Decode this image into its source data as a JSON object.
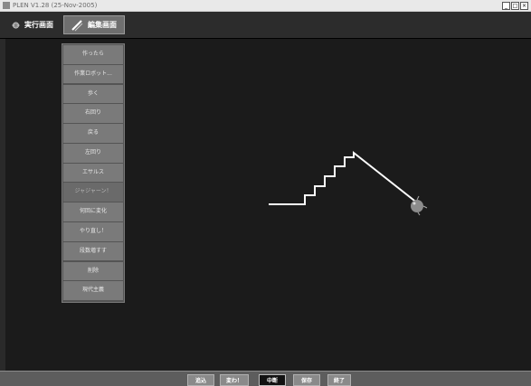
{
  "window": {
    "title": "PLEN V1.28 (25-Nov-2005)",
    "controls": [
      "_",
      "□",
      "×"
    ]
  },
  "toolbar": {
    "run_label": "実行画面",
    "edit_label": "編集画面"
  },
  "command_menu": {
    "items": [
      {
        "label": "作ったら",
        "enabled": true
      },
      {
        "label": "作業ロボット...",
        "enabled": true
      },
      {
        "label": "歩く",
        "enabled": true
      },
      {
        "label": "右回り",
        "enabled": true
      },
      {
        "label": "戻る",
        "enabled": true
      },
      {
        "label": "左回り",
        "enabled": true
      },
      {
        "label": "エサルス",
        "enabled": true
      },
      {
        "label": "ジャジャーン！",
        "enabled": false
      },
      {
        "label": "何回に変化",
        "enabled": true
      },
      {
        "label": "やり直し！",
        "enabled": true
      },
      {
        "label": "段数増すす",
        "enabled": true
      },
      {
        "label": "削除",
        "enabled": true
      },
      {
        "label": "現代主義",
        "enabled": true
      }
    ]
  },
  "canvas": {
    "line_color": "#ffffff",
    "robot_color": "#8c8c8c"
  },
  "bottom_bar": {
    "buttons": [
      {
        "label": "追込",
        "active": false
      },
      {
        "label": "変わ！",
        "active": false
      },
      {
        "label": "中断",
        "active": true
      },
      {
        "label": "保存",
        "active": false
      },
      {
        "label": "終了",
        "active": false
      }
    ]
  }
}
